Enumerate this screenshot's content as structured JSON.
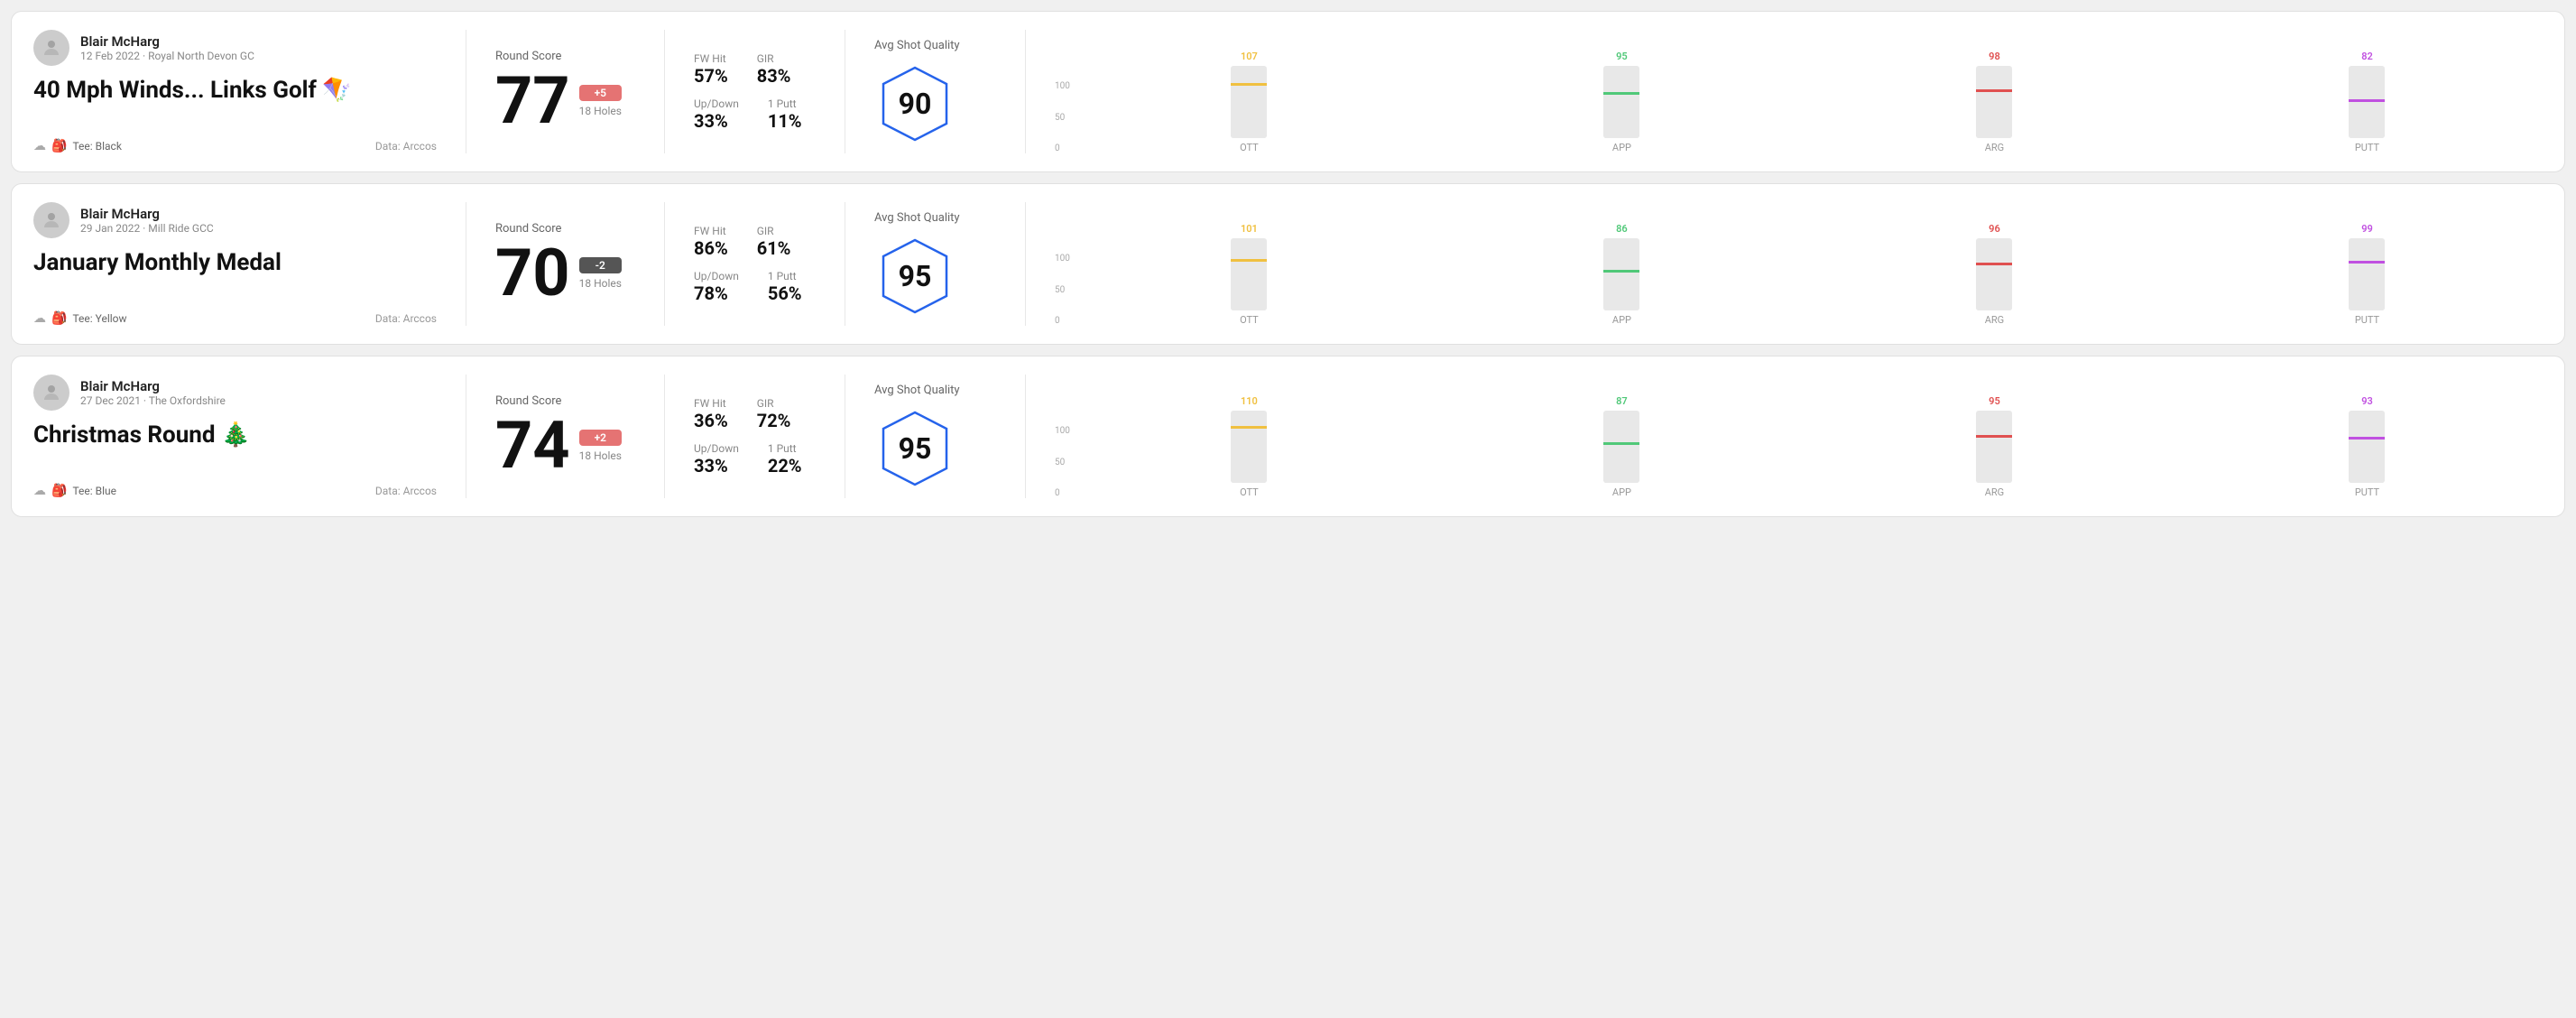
{
  "rounds": [
    {
      "id": "round-1",
      "user_name": "Blair McHarg",
      "user_meta": "12 Feb 2022 · Royal North Devon GC",
      "title": "40 Mph Winds... Links Golf 🪁",
      "tee": "Black",
      "data_source": "Data: Arccos",
      "score": "77",
      "score_diff": "+5",
      "score_diff_sign": "positive",
      "holes": "18 Holes",
      "fw_hit": "57%",
      "gir": "83%",
      "up_down": "33%",
      "one_putt": "11%",
      "avg_quality": "90",
      "chart": {
        "bars": [
          {
            "id": "ott",
            "label": "OTT",
            "value": 107,
            "color": "#f0c040",
            "fill_pct": 72
          },
          {
            "id": "app",
            "label": "APP",
            "value": 95,
            "color": "#50c878",
            "fill_pct": 60
          },
          {
            "id": "arg",
            "label": "ARG",
            "value": 98,
            "color": "#e05050",
            "fill_pct": 64
          },
          {
            "id": "putt",
            "label": "PUTT",
            "value": 82,
            "color": "#c050e0",
            "fill_pct": 50
          }
        ]
      }
    },
    {
      "id": "round-2",
      "user_name": "Blair McHarg",
      "user_meta": "29 Jan 2022 · Mill Ride GCC",
      "title": "January Monthly Medal",
      "tee": "Yellow",
      "data_source": "Data: Arccos",
      "score": "70",
      "score_diff": "-2",
      "score_diff_sign": "negative",
      "holes": "18 Holes",
      "fw_hit": "86%",
      "gir": "61%",
      "up_down": "78%",
      "one_putt": "56%",
      "avg_quality": "95",
      "chart": {
        "bars": [
          {
            "id": "ott",
            "label": "OTT",
            "value": 101,
            "color": "#f0c040",
            "fill_pct": 68
          },
          {
            "id": "app",
            "label": "APP",
            "value": 86,
            "color": "#50c878",
            "fill_pct": 52
          },
          {
            "id": "arg",
            "label": "ARG",
            "value": 96,
            "color": "#e05050",
            "fill_pct": 63
          },
          {
            "id": "putt",
            "label": "PUTT",
            "value": 99,
            "color": "#c050e0",
            "fill_pct": 65
          }
        ]
      }
    },
    {
      "id": "round-3",
      "user_name": "Blair McHarg",
      "user_meta": "27 Dec 2021 · The Oxfordshire",
      "title": "Christmas Round 🎄",
      "tee": "Blue",
      "data_source": "Data: Arccos",
      "score": "74",
      "score_diff": "+2",
      "score_diff_sign": "positive",
      "holes": "18 Holes",
      "fw_hit": "36%",
      "gir": "72%",
      "up_down": "33%",
      "one_putt": "22%",
      "avg_quality": "95",
      "chart": {
        "bars": [
          {
            "id": "ott",
            "label": "OTT",
            "value": 110,
            "color": "#f0c040",
            "fill_pct": 75
          },
          {
            "id": "app",
            "label": "APP",
            "value": 87,
            "color": "#50c878",
            "fill_pct": 53
          },
          {
            "id": "arg",
            "label": "ARG",
            "value": 95,
            "color": "#e05050",
            "fill_pct": 62
          },
          {
            "id": "putt",
            "label": "PUTT",
            "value": 93,
            "color": "#c050e0",
            "fill_pct": 60
          }
        ]
      }
    }
  ],
  "labels": {
    "round_score": "Round Score",
    "fw_hit": "FW Hit",
    "gir": "GIR",
    "up_down": "Up/Down",
    "one_putt": "1 Putt",
    "avg_shot_quality": "Avg Shot Quality",
    "tee_prefix": "Tee:",
    "chart_y_100": "100",
    "chart_y_50": "50",
    "chart_y_0": "0"
  }
}
